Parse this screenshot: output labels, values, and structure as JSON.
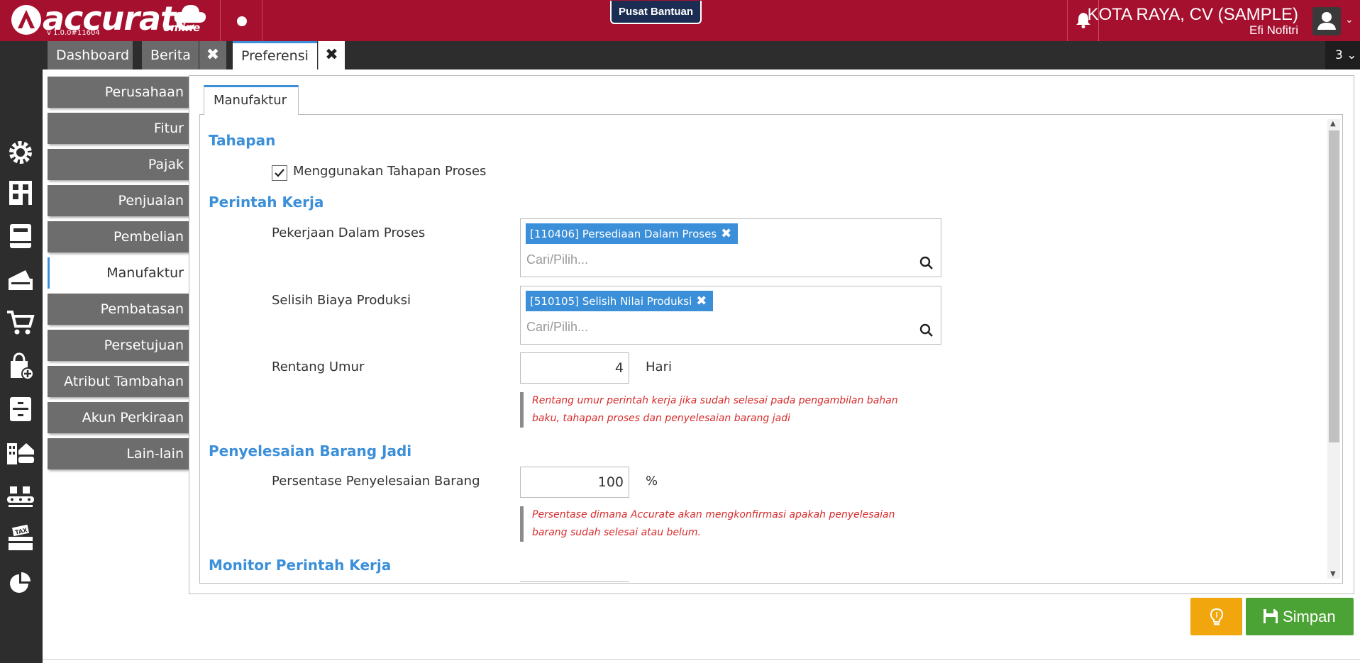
{
  "header": {
    "logo_text": "accurate",
    "logo_sub": "online",
    "version": "v 1.0.0#11604",
    "help_button": "Pusat Bantuan",
    "company_name": "KOTA RAYA, CV (SAMPLE)",
    "user_name": "Efi Nofitri"
  },
  "tabs": [
    {
      "label": "Dashboard",
      "closable": false
    },
    {
      "label": "Berita",
      "closable": true
    },
    {
      "label": "Preferensi",
      "closable": true,
      "active": true
    }
  ],
  "tab_count": "3",
  "pref_menu": [
    "Perusahaan",
    "Fitur",
    "Pajak",
    "Penjualan",
    "Pembelian",
    "Manufaktur",
    "Pembatasan",
    "Persetujuan",
    "Atribut Tambahan",
    "Akun Perkiraan",
    "Lain-lain"
  ],
  "pref_active": "Manufaktur",
  "inner_tab": "Manufaktur",
  "form": {
    "tahapan": {
      "title": "Tahapan",
      "checkbox_label": "Menggunakan Tahapan Proses",
      "checked": true
    },
    "perintah_kerja": {
      "title": "Perintah Kerja",
      "wip_label": "Pekerjaan Dalam Proses",
      "wip_chip": "[110406] Persediaan Dalam Proses",
      "wip_placeholder": "Cari/Pilih...",
      "selisih_label": "Selisih Biaya Produksi",
      "selisih_chip": "[510105] Selisih Nilai Produksi",
      "selisih_placeholder": "Cari/Pilih...",
      "rentang_label": "Rentang Umur",
      "rentang_value": "4",
      "rentang_unit": "Hari",
      "rentang_hint": "Rentang umur perintah kerja jika sudah selesai pada pengambilan bahan baku, tahapan proses dan penyelesaian barang jadi"
    },
    "penyelesaian": {
      "title": "Penyelesaian Barang Jadi",
      "persen_label": "Persentase Penyelesaian Barang",
      "persen_value": "100",
      "persen_unit": "%",
      "persen_hint": "Persentase dimana Accurate akan mengkonfirmasi apakah penyelesaian barang sudah selesai atau belum."
    },
    "monitor": {
      "title": "Monitor Perintah Kerja"
    }
  },
  "buttons": {
    "save": "Simpan"
  },
  "colors": {
    "header": "#a6102f",
    "accent": "#3b8fd9",
    "save": "#4aa334",
    "tip": "#f2a60d",
    "hint": "#d62b2b"
  }
}
